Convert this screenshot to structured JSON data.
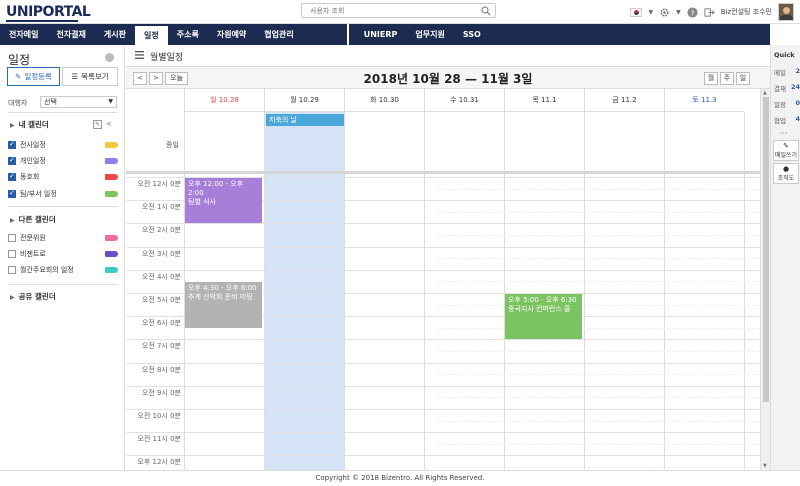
{
  "header": {
    "logo": "UNIPORTAL",
    "search_placeholder": "사용자 조회",
    "user_label": "Biz컨설팅 조수민"
  },
  "nav": {
    "left": [
      "전자메일",
      "전자결재",
      "게시판",
      "일정",
      "주소록",
      "자원예약",
      "협업관리"
    ],
    "right": [
      "UNIERP",
      "업무지원",
      "SSO"
    ],
    "active": "일정"
  },
  "sidebar": {
    "title": "일정",
    "register_button": "일정등록",
    "list_button": "목록보기",
    "delegate_label": "대행자",
    "delegate_value": "선택",
    "my_calendars": {
      "title": "내 캘린더",
      "items": [
        {
          "label": "전사일정",
          "checked": true,
          "color": "#f2c744"
        },
        {
          "label": "개인일정",
          "checked": true,
          "color": "#8a7ef2"
        },
        {
          "label": "동호회",
          "checked": true,
          "color": "#e94848"
        },
        {
          "label": "팀/부서 일정",
          "checked": true,
          "color": "#7cc462"
        }
      ]
    },
    "other_calendars": {
      "title": "다른 캘린더",
      "items": [
        {
          "label": "전문위원",
          "checked": false,
          "color": "#f06ca0"
        },
        {
          "label": "비젠트로",
          "checked": false,
          "color": "#6a4fc9"
        },
        {
          "label": "월간주요회의 일정",
          "checked": false,
          "color": "#3fc9c9"
        }
      ]
    },
    "shared_calendars": {
      "title": "공유 캘린더"
    }
  },
  "calendar": {
    "header_title": "월별일정",
    "today_button": "오늘",
    "prev_label": "<",
    "next_label": ">",
    "range_title": "2018년 10월 28 — 11월 3일",
    "view_buttons": [
      "월",
      "주",
      "일"
    ],
    "allday_label": "종일",
    "days": [
      {
        "label": "일 10.28",
        "type": "sun"
      },
      {
        "label": "월 10.29",
        "type": "weekday"
      },
      {
        "label": "화 10.30",
        "type": "weekday"
      },
      {
        "label": "수 10.31",
        "type": "weekday"
      },
      {
        "label": "목 11.1",
        "type": "weekday"
      },
      {
        "label": "금 11.2",
        "type": "weekday"
      },
      {
        "label": "토 11.3",
        "type": "sat"
      }
    ],
    "today_index": 1,
    "hours": [
      "오전 12시 0분",
      "오전 1시 0분",
      "오전 2시 0분",
      "오전 3시 0분",
      "오전 4시 0분",
      "오전 5시 0분",
      "오전 6시 0분",
      "오전 7시 0분",
      "오전 8시 0분",
      "오전 9시 0분",
      "오전 10시 0분",
      "오전 11시 0분",
      "오후 12시 0분"
    ],
    "allday_events": [
      {
        "day": 1,
        "title": "저축의 날",
        "color": "#4aa8d8"
      }
    ],
    "events": [
      {
        "day": 0,
        "start": 0,
        "end": 2,
        "time": "오후 12:00 - 오후 2:00",
        "title": "팀별 식사",
        "color": "#a77fd9"
      },
      {
        "day": 0,
        "start": 4.5,
        "end": 6.5,
        "time": "오후 4:30 - 오후 6:00",
        "title": "추계 산악회 준비 미팅",
        "color": "#b3b3b3"
      },
      {
        "day": 4,
        "start": 5,
        "end": 7,
        "time": "오후 5:00 - 오후 6:30",
        "title": "중국지사 컨퍼런스 콜",
        "color": "#7cc462"
      }
    ]
  },
  "quick": {
    "title": "Quick",
    "items": [
      {
        "label": "메일",
        "count": "2"
      },
      {
        "label": "결재",
        "count": "24"
      },
      {
        "label": "일정",
        "count": "0"
      },
      {
        "label": "협업",
        "count": "4"
      }
    ],
    "more": "···",
    "write_mail": "메일쓰기",
    "org_chart": "조직도"
  },
  "footer": {
    "copyright": "Copyright © 2018 Bizentro. All Rights Reserved."
  }
}
